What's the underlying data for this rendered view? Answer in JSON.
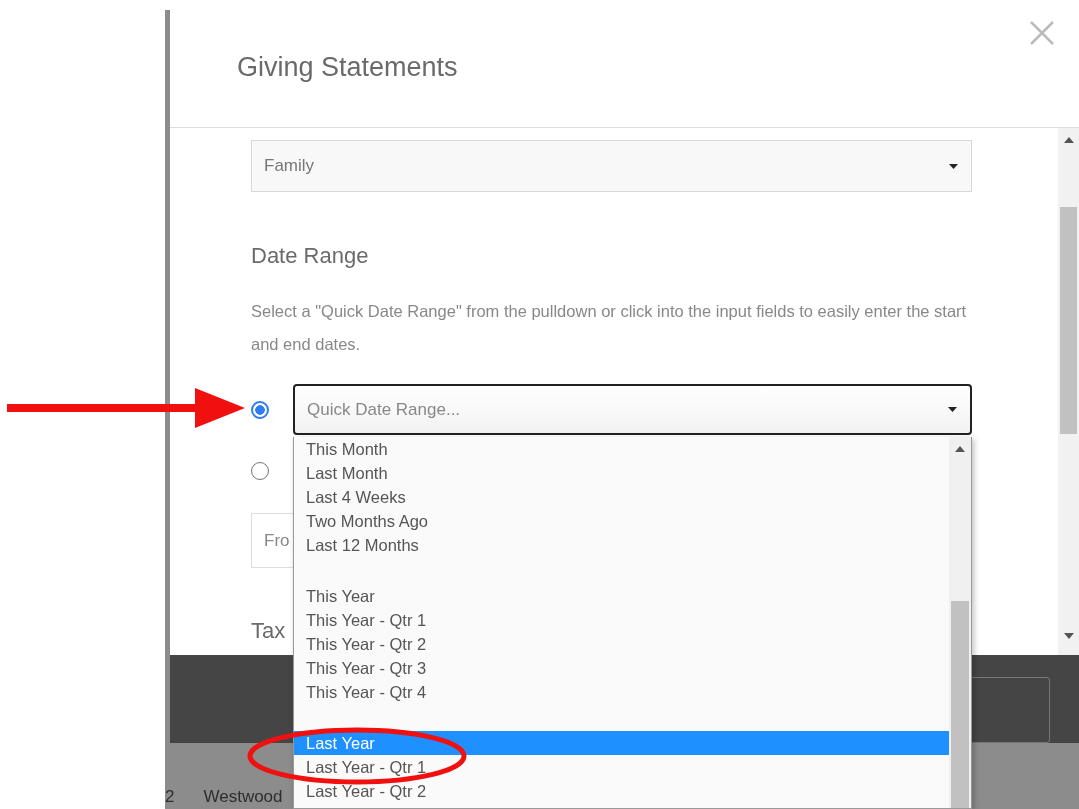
{
  "background_page": {
    "row_texts": [
      "2",
      "Westwood"
    ]
  },
  "modal": {
    "title": "Giving Statements",
    "statement_type": {
      "value": "Family"
    },
    "date_range": {
      "heading": "Date Range",
      "help": "Select a \"Quick Date Range\" from the pulldown or click into the input fields to easily enter the start and end dates.",
      "options": [
        {
          "kind": "quick",
          "selected": true
        },
        {
          "kind": "custom",
          "selected": false
        }
      ],
      "quick_select": {
        "placeholder": "Quick Date Range..."
      },
      "from_field": {
        "placeholder": "Fro"
      }
    },
    "tax_heading": "Tax"
  },
  "dropdown": {
    "items": [
      {
        "kind": "option",
        "label": "This Month",
        "selected": false
      },
      {
        "kind": "option",
        "label": "Last Month",
        "selected": false
      },
      {
        "kind": "option",
        "label": "Last 4 Weeks",
        "selected": false
      },
      {
        "kind": "option",
        "label": "Two Months Ago",
        "selected": false
      },
      {
        "kind": "option",
        "label": "Last 12 Months",
        "selected": false
      },
      {
        "kind": "blank"
      },
      {
        "kind": "option",
        "label": "This Year",
        "selected": false
      },
      {
        "kind": "option",
        "label": "This Year - Qtr 1",
        "selected": false
      },
      {
        "kind": "option",
        "label": "This Year - Qtr 2",
        "selected": false
      },
      {
        "kind": "option",
        "label": "This Year - Qtr 3",
        "selected": false
      },
      {
        "kind": "option",
        "label": "This Year - Qtr 4",
        "selected": false
      },
      {
        "kind": "blank"
      },
      {
        "kind": "option",
        "label": "Last Year",
        "selected": true
      },
      {
        "kind": "option",
        "label": "Last Year - Qtr 1",
        "selected": false
      },
      {
        "kind": "option",
        "label": "Last Year - Qtr 2",
        "selected": false
      }
    ]
  },
  "annotations": [
    {
      "kind": "arrow"
    },
    {
      "kind": "ellipse"
    }
  ]
}
